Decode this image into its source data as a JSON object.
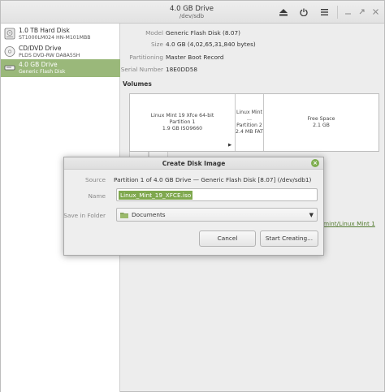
{
  "window": {
    "title": "4.0 GB Drive",
    "subtitle": "/dev/sdb"
  },
  "toolbar": {
    "eject_icon": "eject-icon",
    "power_icon": "power-icon",
    "menu_icon": "menu-icon"
  },
  "window_controls": [
    "minimize-icon",
    "maximize-icon",
    "close-icon"
  ],
  "sidebar": {
    "drives": [
      {
        "name": "1.0 TB Hard Disk",
        "model": "ST1000LM024 HN-M101MBB",
        "icon": "hard-disk-icon"
      },
      {
        "name": "CD/DVD Drive",
        "model": "PLDS    DVD-RW DA8A5SH",
        "icon": "optical-drive-icon"
      },
      {
        "name": "4.0 GB Drive",
        "model": "Generic Flash Disk",
        "icon": "usb-drive-icon",
        "selected": true
      }
    ]
  },
  "details": {
    "model_label": "Model",
    "model_value": "Generic Flash Disk (8.07)",
    "size_label": "Size",
    "size_value": "4.0 GB (4,02,65,31,840 bytes)",
    "partitioning_label": "Partitioning",
    "partitioning_value": "Master Boot Record",
    "serial_label": "Serial Number",
    "serial_value": "18E0DD58",
    "volumes_label": "Volumes",
    "partitions": [
      {
        "line1": "Linux Mint 19 Xfce 64-bit",
        "line2": "Partition 1",
        "line3": "1.9 GB ISO9660"
      },
      {
        "line1": "Linux Mint ...",
        "line2": "Partition 2",
        "line3": "2.4 MB FAT"
      },
      {
        "line1": "Free Space",
        "line2": "2.1 GB",
        "line3": ""
      }
    ],
    "link_peek": "cmint/Linux Mint 1"
  },
  "dialog": {
    "title": "Create Disk Image",
    "source_label": "Source",
    "source_value": "Partition 1 of 4.0 GB Drive — Generic Flash Disk [8.07] (/dev/sdb1)",
    "name_label": "Name",
    "name_value": "Linux_Mint_19_XFCE.iso",
    "folder_label": "Save in Folder",
    "folder_value": "Documents",
    "cancel_label": "Cancel",
    "start_label": "Start Creating..."
  },
  "colors": {
    "accent": "#9ab87a",
    "selection": "#7fa84e"
  }
}
